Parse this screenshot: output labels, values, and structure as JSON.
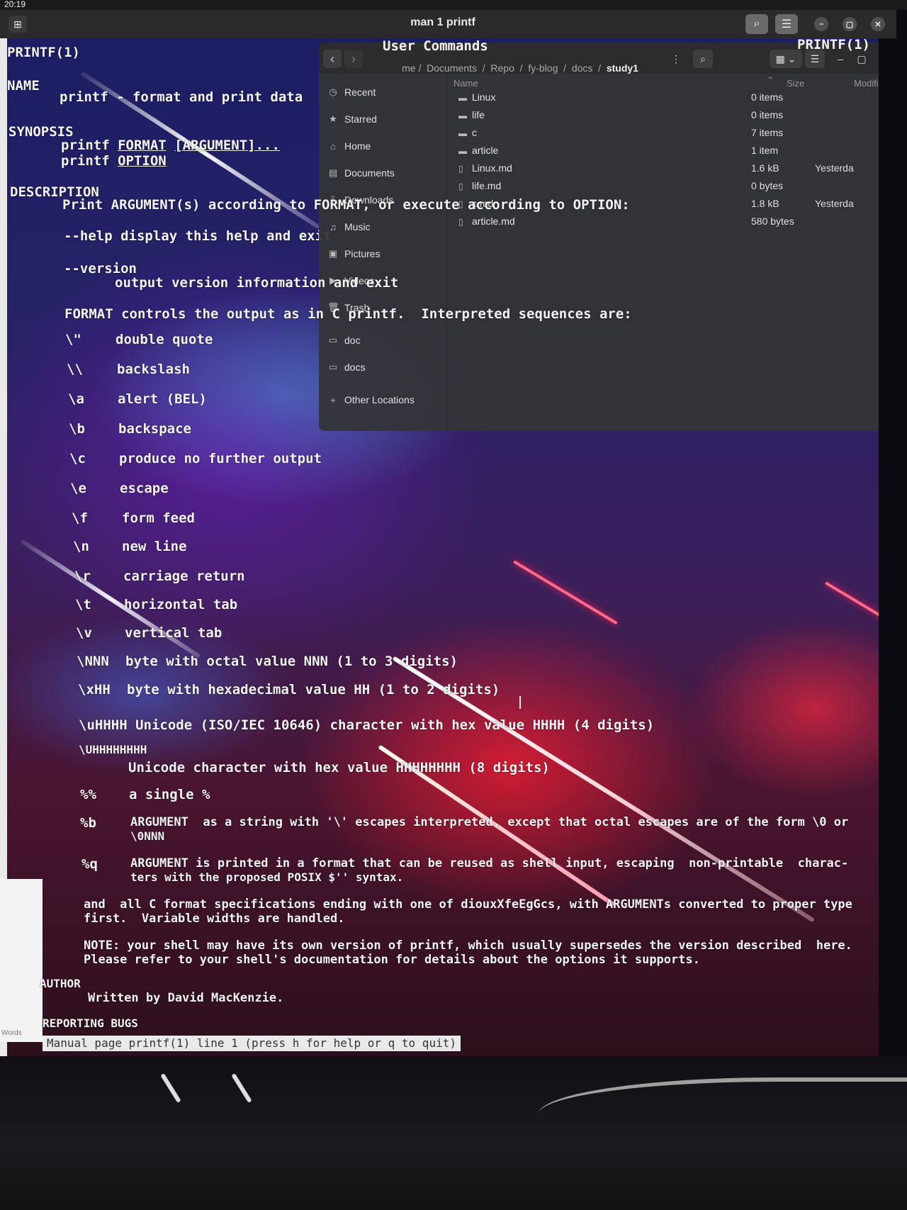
{
  "system": {
    "clock": "20:19"
  },
  "terminal": {
    "title": "man 1 printf",
    "header_left": "PRINTF(1)",
    "header_center": "User Commands",
    "header_right": "PRINTF(1)",
    "status_line": "Manual page printf(1) line 1 (press h for help or q to quit)"
  },
  "man": {
    "name_heading": "NAME",
    "name_text": "printf - format and print data",
    "synopsis_heading": "SYNOPSIS",
    "synopsis_cmd": "printf",
    "synopsis_format": "FORMAT",
    "synopsis_argument": "[ARGUMENT]...",
    "synopsis_option": "OPTION",
    "description_heading": "DESCRIPTION",
    "description_text": "Print ARGUMENT(s) according to FORMAT, or execute according to OPTION:",
    "help_line": "--help display this help and exit",
    "version_flag": "--version",
    "version_text": "output version information and exit",
    "format_intro": "FORMAT controls the output as in C printf.  Interpreted sequences are:",
    "sequences": [
      {
        "seq": "\\\"",
        "desc": "double quote"
      },
      {
        "seq": "\\\\",
        "desc": "backslash"
      },
      {
        "seq": "\\a",
        "desc": "alert (BEL)"
      },
      {
        "seq": "\\b",
        "desc": "backspace"
      },
      {
        "seq": "\\c",
        "desc": "produce no further output"
      },
      {
        "seq": "\\e",
        "desc": "escape"
      },
      {
        "seq": "\\f",
        "desc": "form feed"
      },
      {
        "seq": "\\n",
        "desc": "new line"
      },
      {
        "seq": "\\r",
        "desc": "carriage return"
      },
      {
        "seq": "\\t",
        "desc": "horizontal tab"
      },
      {
        "seq": "\\v",
        "desc": "vertical tab"
      },
      {
        "seq": "\\NNN",
        "desc": "byte with octal value NNN (1 to 3 digits)"
      },
      {
        "seq": "\\xHH",
        "desc": "byte with hexadecimal value HH (1 to 2 digits)"
      }
    ],
    "uhhhh_line": "\\uHHHH Unicode (ISO/IEC 10646) character with hex value HHHH (4 digits)",
    "uhhhhhhhh_seq": "\\UHHHHHHHH",
    "uhhhhhhhh_desc": "Unicode character with hex value HHHHHHHH (8 digits)",
    "pct_seq": "%%",
    "pct_desc": "a single %",
    "b_seq": "%b",
    "b_desc_1": "ARGUMENT  as a string with '\\' escapes interpreted, except that octal escapes are of the form \\0 or",
    "b_desc_2": "\\0NNN",
    "q_seq": "%q",
    "q_desc_1": "ARGUMENT is printed in a format that can be reused as shell input, escaping  non-printable  charac-",
    "q_desc_2": "ters with the proposed POSIX $'' syntax.",
    "and_1": "and  all C format specifications ending with one of diouxXfeEgGcs, with ARGUMENTs converted to proper type",
    "and_2": "first.  Variable widths are handled.",
    "note_1": "NOTE: your shell may have its own version of printf, which usually supersedes the version described  here.",
    "note_2": "Please refer to your shell's documentation for details about the options it supports.",
    "author_heading": "AUTHOR",
    "author_text": "Written by David MacKenzie.",
    "bugs_heading": "REPORTING BUGS"
  },
  "file_manager": {
    "breadcrumb": [
      "me",
      "Documents",
      "Repo",
      "fy-blog",
      "docs"
    ],
    "breadcrumb_current": "study1",
    "sidebar": [
      {
        "label": "Recent",
        "icon": "clock-icon"
      },
      {
        "label": "Starred",
        "icon": "star-icon"
      },
      {
        "label": "Home",
        "icon": "home-icon"
      },
      {
        "label": "Documents",
        "icon": "document-icon"
      },
      {
        "label": "Downloads",
        "icon": "download-icon"
      },
      {
        "label": "Music",
        "icon": "music-icon"
      },
      {
        "label": "Pictures",
        "icon": "picture-icon"
      },
      {
        "label": "Videos",
        "icon": "video-icon"
      },
      {
        "label": "Trash",
        "icon": "trash-icon"
      },
      {
        "label": "doc",
        "icon": "folder-icon"
      },
      {
        "label": "docs",
        "icon": "folder-icon"
      },
      {
        "label": "Other Locations",
        "icon": "plus-icon"
      }
    ],
    "columns": {
      "name": "Name",
      "size": "Size",
      "modified": "Modifie"
    },
    "files": [
      {
        "name": "Linux",
        "type": "folder",
        "size": "0 items",
        "modified": ""
      },
      {
        "name": "life",
        "type": "folder",
        "size": "0 items",
        "modified": ""
      },
      {
        "name": "c",
        "type": "folder",
        "size": "7 items",
        "modified": ""
      },
      {
        "name": "article",
        "type": "folder",
        "size": "1 item",
        "modified": ""
      },
      {
        "name": "Linux.md",
        "type": "file",
        "size": "1.6 kB",
        "modified": "Yesterda"
      },
      {
        "name": "life.md",
        "type": "file",
        "size": "0 bytes",
        "modified": ""
      },
      {
        "name": "c.md",
        "type": "file",
        "size": "1.8 kB",
        "modified": "Yesterda"
      },
      {
        "name": "article.md",
        "type": "file",
        "size": "580 bytes",
        "modified": ""
      }
    ]
  },
  "sidebar_app": {
    "words_label": "Words"
  }
}
